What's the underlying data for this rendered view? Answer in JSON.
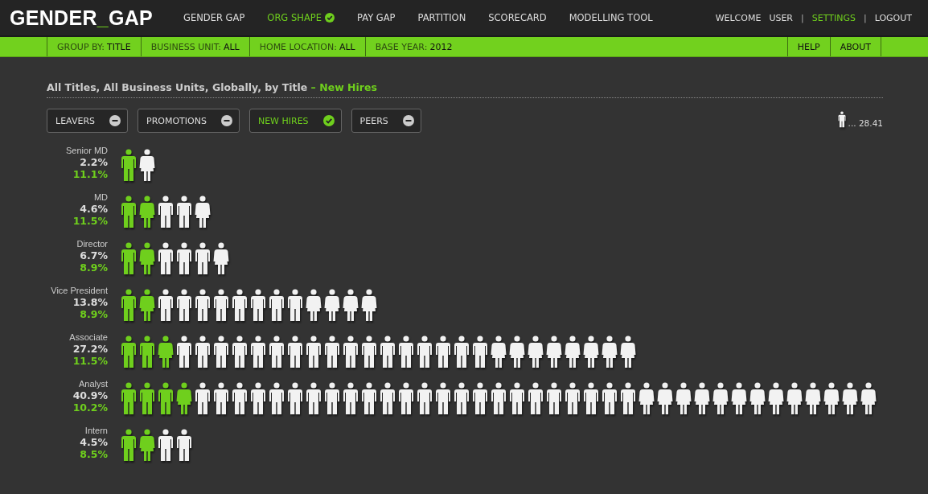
{
  "logo": {
    "before": "GENDER",
    "accent": "_",
    "after": "GAP"
  },
  "nav": [
    {
      "label": "GENDER GAP",
      "selected": false
    },
    {
      "label": "ORG SHAPE",
      "selected": true
    },
    {
      "label": "PAY GAP",
      "selected": false
    },
    {
      "label": "PARTITION",
      "selected": false
    },
    {
      "label": "SCORECARD",
      "selected": false
    },
    {
      "label": "MODELLING TOOL",
      "selected": false
    }
  ],
  "user_menu": [
    {
      "kind": "text",
      "label": "WELCOME",
      "selected": false
    },
    {
      "kind": "text",
      "label": "USER",
      "selected": false
    },
    {
      "kind": "separator",
      "label": "|",
      "selected": false
    },
    {
      "kind": "link",
      "label": "SETTINGS",
      "selected": true
    },
    {
      "kind": "separator",
      "label": "|",
      "selected": false
    },
    {
      "kind": "link",
      "label": "LOGOUT",
      "selected": false
    }
  ],
  "filters": [
    {
      "label": "GROUP BY:",
      "value": "TITLE"
    },
    {
      "label": "BUSINESS UNIT:",
      "value": "ALL"
    },
    {
      "label": "HOME LOCATION:",
      "value": "ALL"
    },
    {
      "label": "BASE YEAR:",
      "value": "2012"
    }
  ],
  "help_links": [
    "HELP",
    "ABOUT"
  ],
  "heading": {
    "title": "All Titles, All Business Units, Globally, by Title",
    "subtitle": "– New Hires"
  },
  "toggles": [
    {
      "label": "LEAVERS",
      "selected": false
    },
    {
      "label": "PROMOTIONS",
      "selected": false
    },
    {
      "label": "NEW HIRES",
      "selected": true
    },
    {
      "label": "PEERS",
      "selected": false
    }
  ],
  "legend": {
    "text": "... 28.41"
  },
  "rows": [
    {
      "title": "Senior MD",
      "total": "2.2%",
      "hires": "11.1%",
      "figures": [
        {
          "kind": "man",
          "highlighted": true
        },
        {
          "kind": "woman",
          "highlighted": false
        }
      ]
    },
    {
      "title": "MD",
      "total": "4.6%",
      "hires": "11.5%",
      "figures": [
        {
          "kind": "man",
          "highlighted": true
        },
        {
          "kind": "woman",
          "highlighted": true
        },
        {
          "kind": "man",
          "highlighted": false
        },
        {
          "kind": "man",
          "highlighted": false
        },
        {
          "kind": "woman",
          "highlighted": false
        }
      ]
    },
    {
      "title": "Director",
      "total": "6.7%",
      "hires": "8.9%",
      "figures": [
        {
          "kind": "man",
          "highlighted": true
        },
        {
          "kind": "woman",
          "highlighted": true
        },
        {
          "kind": "man",
          "highlighted": false
        },
        {
          "kind": "man",
          "highlighted": false
        },
        {
          "kind": "man",
          "highlighted": false
        },
        {
          "kind": "woman",
          "highlighted": false
        }
      ]
    },
    {
      "title": "Vice President",
      "total": "13.8%",
      "hires": "8.9%",
      "figures": [
        {
          "kind": "man",
          "highlighted": true
        },
        {
          "kind": "woman",
          "highlighted": true
        },
        {
          "kind": "man",
          "highlighted": false
        },
        {
          "kind": "man",
          "highlighted": false
        },
        {
          "kind": "man",
          "highlighted": false
        },
        {
          "kind": "man",
          "highlighted": false
        },
        {
          "kind": "man",
          "highlighted": false
        },
        {
          "kind": "man",
          "highlighted": false
        },
        {
          "kind": "man",
          "highlighted": false
        },
        {
          "kind": "man",
          "highlighted": false
        },
        {
          "kind": "woman",
          "highlighted": false
        },
        {
          "kind": "woman",
          "highlighted": false
        },
        {
          "kind": "woman",
          "highlighted": false
        },
        {
          "kind": "woman",
          "highlighted": false
        }
      ]
    },
    {
      "title": "Associate",
      "total": "27.2%",
      "hires": "11.5%",
      "figures": [
        {
          "kind": "man",
          "highlighted": true
        },
        {
          "kind": "man",
          "highlighted": true
        },
        {
          "kind": "woman",
          "highlighted": true
        },
        {
          "kind": "man",
          "highlighted": false
        },
        {
          "kind": "man",
          "highlighted": false
        },
        {
          "kind": "man",
          "highlighted": false
        },
        {
          "kind": "man",
          "highlighted": false
        },
        {
          "kind": "man",
          "highlighted": false
        },
        {
          "kind": "man",
          "highlighted": false
        },
        {
          "kind": "man",
          "highlighted": false
        },
        {
          "kind": "man",
          "highlighted": false
        },
        {
          "kind": "man",
          "highlighted": false
        },
        {
          "kind": "man",
          "highlighted": false
        },
        {
          "kind": "man",
          "highlighted": false
        },
        {
          "kind": "man",
          "highlighted": false
        },
        {
          "kind": "man",
          "highlighted": false
        },
        {
          "kind": "man",
          "highlighted": false
        },
        {
          "kind": "man",
          "highlighted": false
        },
        {
          "kind": "man",
          "highlighted": false
        },
        {
          "kind": "man",
          "highlighted": false
        },
        {
          "kind": "woman",
          "highlighted": false
        },
        {
          "kind": "woman",
          "highlighted": false
        },
        {
          "kind": "woman",
          "highlighted": false
        },
        {
          "kind": "woman",
          "highlighted": false
        },
        {
          "kind": "woman",
          "highlighted": false
        },
        {
          "kind": "woman",
          "highlighted": false
        },
        {
          "kind": "woman",
          "highlighted": false
        },
        {
          "kind": "woman",
          "highlighted": false
        }
      ]
    },
    {
      "title": "Analyst",
      "total": "40.9%",
      "hires": "10.2%",
      "figures": [
        {
          "kind": "man",
          "highlighted": true
        },
        {
          "kind": "man",
          "highlighted": true
        },
        {
          "kind": "man",
          "highlighted": true
        },
        {
          "kind": "woman",
          "highlighted": true
        },
        {
          "kind": "man",
          "highlighted": false
        },
        {
          "kind": "man",
          "highlighted": false
        },
        {
          "kind": "man",
          "highlighted": false
        },
        {
          "kind": "man",
          "highlighted": false
        },
        {
          "kind": "man",
          "highlighted": false
        },
        {
          "kind": "man",
          "highlighted": false
        },
        {
          "kind": "man",
          "highlighted": false
        },
        {
          "kind": "man",
          "highlighted": false
        },
        {
          "kind": "man",
          "highlighted": false
        },
        {
          "kind": "man",
          "highlighted": false
        },
        {
          "kind": "man",
          "highlighted": false
        },
        {
          "kind": "man",
          "highlighted": false
        },
        {
          "kind": "man",
          "highlighted": false
        },
        {
          "kind": "man",
          "highlighted": false
        },
        {
          "kind": "man",
          "highlighted": false
        },
        {
          "kind": "man",
          "highlighted": false
        },
        {
          "kind": "man",
          "highlighted": false
        },
        {
          "kind": "man",
          "highlighted": false
        },
        {
          "kind": "man",
          "highlighted": false
        },
        {
          "kind": "man",
          "highlighted": false
        },
        {
          "kind": "man",
          "highlighted": false
        },
        {
          "kind": "man",
          "highlighted": false
        },
        {
          "kind": "man",
          "highlighted": false
        },
        {
          "kind": "man",
          "highlighted": false
        },
        {
          "kind": "woman",
          "highlighted": false
        },
        {
          "kind": "woman",
          "highlighted": false
        },
        {
          "kind": "woman",
          "highlighted": false
        },
        {
          "kind": "woman",
          "highlighted": false
        },
        {
          "kind": "woman",
          "highlighted": false
        },
        {
          "kind": "woman",
          "highlighted": false
        },
        {
          "kind": "woman",
          "highlighted": false
        },
        {
          "kind": "woman",
          "highlighted": false
        },
        {
          "kind": "woman",
          "highlighted": false
        },
        {
          "kind": "woman",
          "highlighted": false
        },
        {
          "kind": "woman",
          "highlighted": false
        },
        {
          "kind": "woman",
          "highlighted": false
        },
        {
          "kind": "woman",
          "highlighted": false
        }
      ]
    },
    {
      "title": "Intern",
      "total": "4.5%",
      "hires": "8.5%",
      "figures": [
        {
          "kind": "man",
          "highlighted": true
        },
        {
          "kind": "woman",
          "highlighted": true
        },
        {
          "kind": "man",
          "highlighted": false
        },
        {
          "kind": "man",
          "highlighted": false
        }
      ]
    }
  ]
}
